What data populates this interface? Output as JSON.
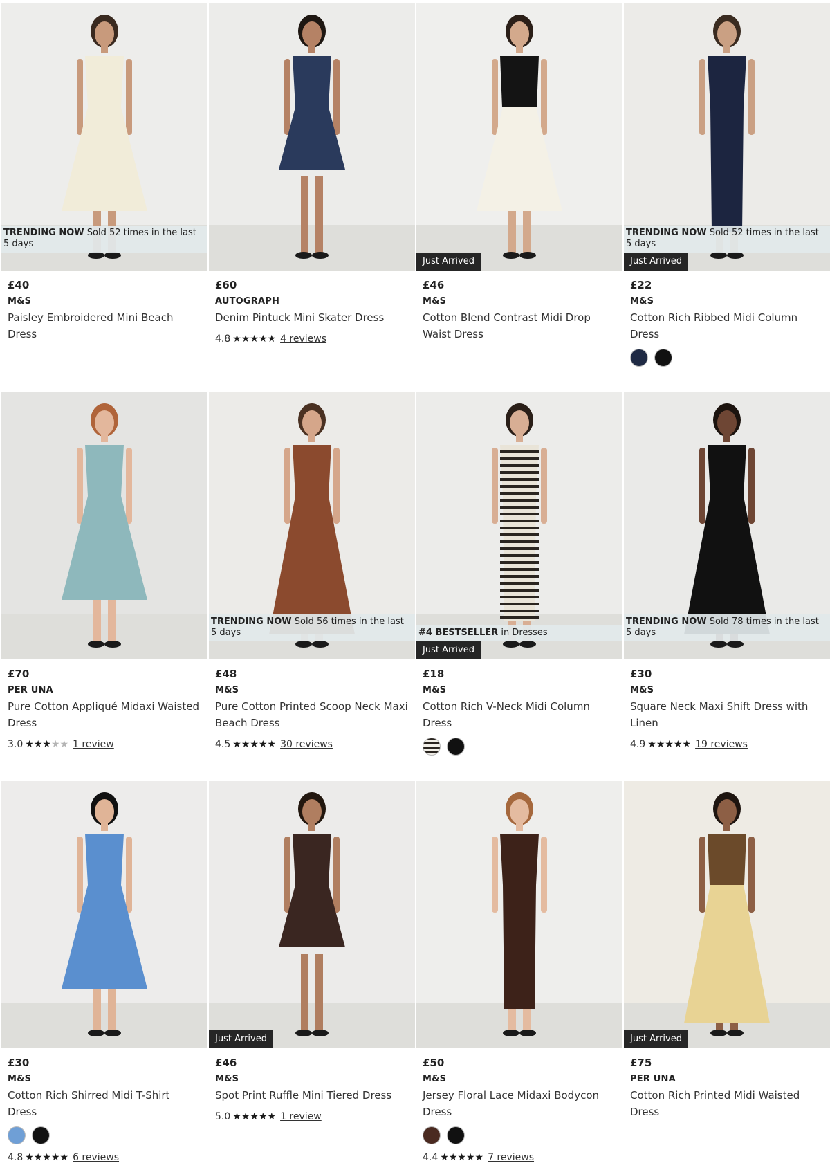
{
  "labels": {
    "trending_prefix": "TRENDING NOW",
    "just_arrived": "Just Arrived"
  },
  "products": [
    {
      "price": "£40",
      "brand": "M&S",
      "title": "Paisley Embroidered Mini Beach Dress",
      "badge": "Sold 52 times in the last 5 days",
      "just_arrived": false,
      "rating": null,
      "reviews": null,
      "rating_value": null,
      "swatches": [],
      "image": {
        "bg": "#ededeb",
        "dress": "#f1ecd9",
        "skin": "#c89a7c",
        "hair": "#3a2a20",
        "shape": "a-line"
      }
    },
    {
      "price": "£60",
      "brand": "AUTOGRAPH",
      "title": "Denim Pintuck Mini Skater Dress",
      "badge": null,
      "just_arrived": false,
      "rating": "4.8",
      "reviews": "4 reviews",
      "rating_value": 4.8,
      "swatches": [],
      "image": {
        "bg": "#ececea",
        "dress": "#2a3a5c",
        "skin": "#b58265",
        "hair": "#1e1712",
        "shape": "mini"
      }
    },
    {
      "price": "£46",
      "brand": "M&S",
      "title": "Cotton Blend Contrast Midi Drop Waist Dress",
      "badge": null,
      "just_arrived": true,
      "rating": null,
      "reviews": null,
      "rating_value": null,
      "swatches": [],
      "image": {
        "bg": "#efefed",
        "dress": "#f4f1e6",
        "top": "#141414",
        "skin": "#d3a98c",
        "hair": "#2b1f18",
        "shape": "two-tone"
      }
    },
    {
      "price": "£22",
      "brand": "M&S",
      "title": "Cotton Rich Ribbed Midi Column Dress",
      "badge": "Sold 52 times in the last 5 days",
      "just_arrived": true,
      "rating": null,
      "reviews": null,
      "rating_value": null,
      "swatches": [
        "#1f2a44",
        "#111111"
      ],
      "image": {
        "bg": "#ecebe8",
        "dress": "#1c2540",
        "skin": "#caa083",
        "hair": "#3a2b20",
        "shape": "column"
      }
    },
    {
      "price": "£70",
      "brand": "PER UNA",
      "title": "Pure Cotton Appliqué Midaxi Waisted Dress",
      "badge": null,
      "just_arrived": false,
      "rating": "3.0",
      "reviews": "1 review",
      "rating_value": 3.0,
      "swatches": [],
      "image": {
        "bg": "#e4e4e2",
        "dress": "#8eb8bc",
        "skin": "#e3b79c",
        "hair": "#b0643a",
        "shape": "a-line"
      }
    },
    {
      "price": "£48",
      "brand": "M&S",
      "title": "Pure Cotton Printed Scoop Neck Maxi Beach Dress",
      "badge": "Sold 56 times in the last 5 days",
      "just_arrived": false,
      "rating": "4.5",
      "reviews": "30 reviews",
      "rating_value": 4.5,
      "swatches": [],
      "image": {
        "bg": "#ecebe8",
        "dress": "#8b4a2e",
        "skin": "#d5a68a",
        "hair": "#4a3122",
        "shape": "maxi"
      }
    },
    {
      "price": "£18",
      "brand": "M&S",
      "title": "Cotton Rich V-Neck Midi Column Dress",
      "badge": "in Dresses",
      "badge_prefix": "#4 BESTSELLER",
      "just_arrived": true,
      "rating": null,
      "reviews": null,
      "rating_value": null,
      "swatches": [
        "stripe",
        "#111111"
      ],
      "image": {
        "bg": "#ececea",
        "dress": "#e9e4d8",
        "skin": "#d8ae94",
        "hair": "#2a1f18",
        "shape": "stripe"
      }
    },
    {
      "price": "£30",
      "brand": "M&S",
      "title": "Square Neck Maxi Shift Dress with Linen",
      "badge": "Sold 78 times in the last 5 days",
      "just_arrived": false,
      "rating": "4.9",
      "reviews": "19 reviews",
      "rating_value": 4.9,
      "swatches": [],
      "image": {
        "bg": "#eaeae8",
        "dress": "#111111",
        "skin": "#6e4634",
        "hair": "#1c140f",
        "shape": "maxi"
      }
    },
    {
      "price": "£30",
      "brand": "M&S",
      "title": "Cotton Rich Shirred Midi T-Shirt Dress",
      "badge": null,
      "just_arrived": false,
      "rating": "4.8",
      "reviews": "6 reviews",
      "rating_value": 4.8,
      "swatches": [
        "#6f9fd6",
        "#111111"
      ],
      "image": {
        "bg": "#edeceb",
        "dress": "#5a8fcf",
        "skin": "#e0b497",
        "hair": "#111111",
        "shape": "a-line"
      }
    },
    {
      "price": "£46",
      "brand": "M&S",
      "title": "Spot Print Ruffle Mini Tiered Dress",
      "badge": null,
      "just_arrived": true,
      "rating": "5.0",
      "reviews": "1 review",
      "rating_value": 5.0,
      "swatches": [],
      "image": {
        "bg": "#ecebea",
        "dress": "#3a2621",
        "skin": "#b07e60",
        "hair": "#22170f",
        "shape": "mini"
      }
    },
    {
      "price": "£50",
      "brand": "M&S",
      "title": "Jersey Floral Lace Midaxi Bodycon Dress",
      "badge": null,
      "just_arrived": false,
      "rating": "4.4",
      "reviews": "7 reviews",
      "rating_value": 4.4,
      "swatches": [
        "#4a2a20",
        "#111111"
      ],
      "image": {
        "bg": "#eeeeec",
        "dress": "#3d2219",
        "skin": "#e4bba0",
        "hair": "#a5683d",
        "shape": "column"
      }
    },
    {
      "price": "£75",
      "brand": "PER UNA",
      "title": "Cotton Rich Printed Midi Waisted Dress",
      "badge": null,
      "just_arrived": true,
      "rating": null,
      "reviews": null,
      "rating_value": null,
      "swatches": [],
      "image": {
        "bg": "#eeebe4",
        "dress": "#e8d394",
        "top": "#6b4a2a",
        "skin": "#8d5f45",
        "hair": "#1e1510",
        "shape": "maxi"
      }
    }
  ]
}
